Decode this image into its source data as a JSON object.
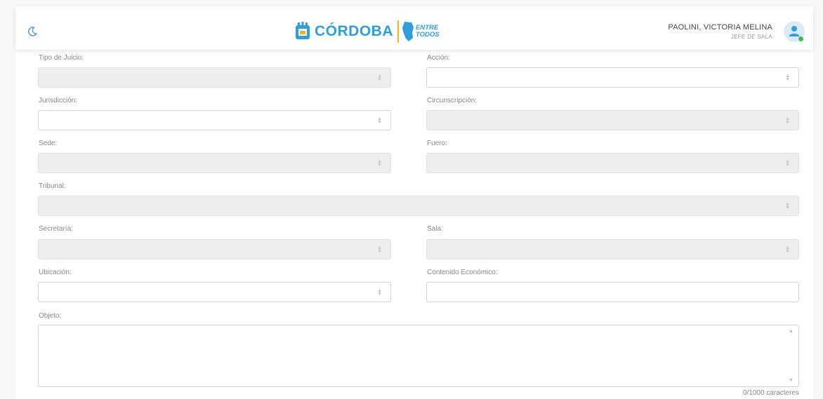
{
  "header": {
    "theme_icon": "moon-icon",
    "brand": {
      "name": "CÓRDOBA",
      "tagline_line1": "ENTRE",
      "tagline_line2": "TODOS"
    },
    "user": {
      "name": "PAOLINI, VICTORIA MELINA",
      "role": "JEFE DE SALA",
      "status_color": "#3cba54"
    }
  },
  "form": {
    "tipo_juicio": {
      "label": "Tipo de Juicio:",
      "value": "",
      "disabled": true
    },
    "accion": {
      "label": "Acción:",
      "value": "",
      "disabled": false
    },
    "jurisdiccion": {
      "label": "Jurisdicción:",
      "value": "",
      "disabled": false
    },
    "circunscripcion": {
      "label": "Circunscripción:",
      "value": "",
      "disabled": true
    },
    "sede": {
      "label": "Sede:",
      "value": "",
      "disabled": true
    },
    "fuero": {
      "label": "Fuero:",
      "value": "",
      "disabled": true
    },
    "tribunal": {
      "label": "Tribunal:",
      "value": "",
      "disabled": true
    },
    "secretaria": {
      "label": "Secretaría:",
      "value": "",
      "disabled": true
    },
    "sala": {
      "label": "Sala:",
      "value": "",
      "disabled": true
    },
    "ubicacion": {
      "label": "Ubicación:",
      "value": "",
      "disabled": false
    },
    "contenido_economico": {
      "label": "Contenido Económico:",
      "value": ""
    },
    "objeto": {
      "label": "Objeto:",
      "value": "",
      "counter": "0/1000 caracteres"
    }
  },
  "colors": {
    "accent": "#2e9ee0",
    "brand_gold": "#f4b31e",
    "disabled_bg": "#eeeeee"
  }
}
